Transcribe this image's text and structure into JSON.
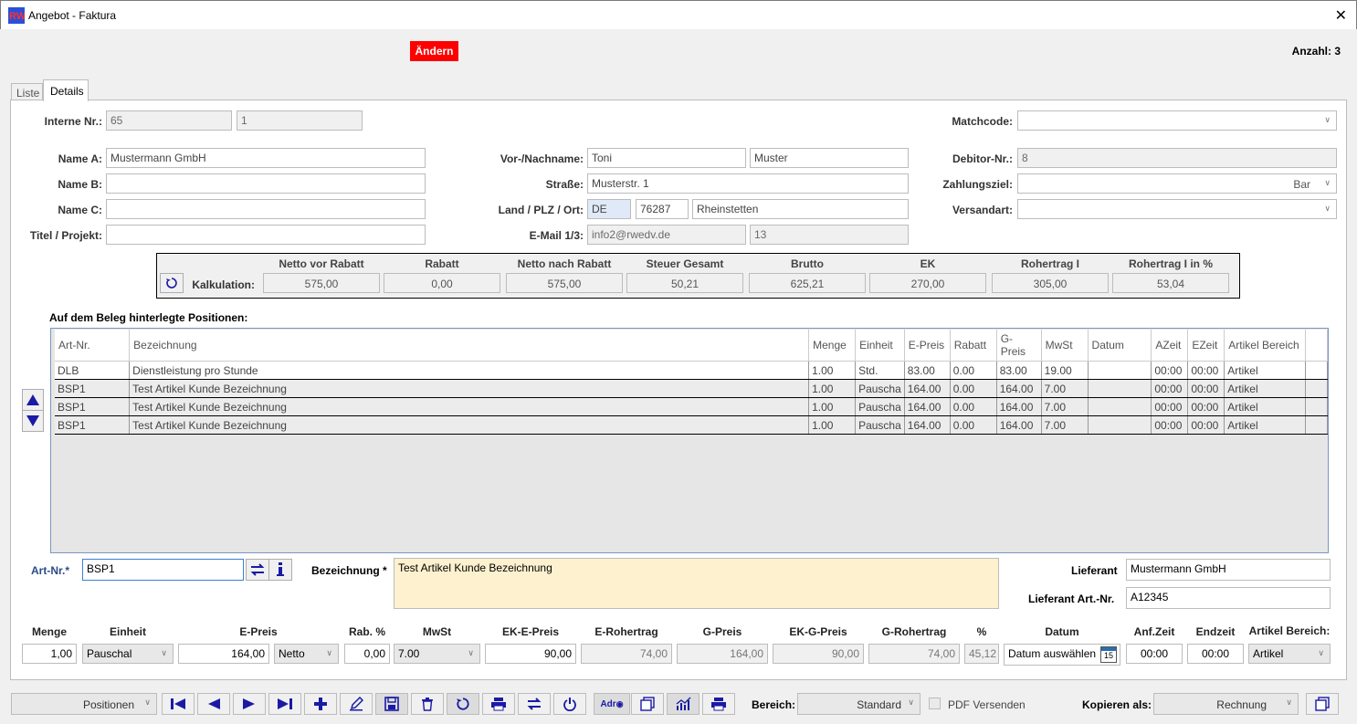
{
  "window": {
    "title": "Angebot - Faktura",
    "app_icon": "RW",
    "close_glyph": "✕"
  },
  "toolbar": {
    "change_button": "Ändern",
    "count_label": "Anzahl: 3"
  },
  "tabs": [
    {
      "label": "Liste"
    },
    {
      "label": "Details"
    }
  ],
  "head": {
    "interne_nr_label": "Interne Nr.:",
    "interne_nr": "65",
    "interne_nr2": "1",
    "matchcode_label": "Matchcode:",
    "matchcode": "",
    "name_a_label": "Name A:",
    "name_a": "Mustermann GmbH",
    "name_b_label": "Name B:",
    "name_b": "",
    "name_c_label": "Name C:",
    "name_c": "",
    "titel_label": "Titel / Projekt:",
    "titel": "",
    "vorname_label": "Vor-/Nachname:",
    "vorname": "Toni",
    "nachname": "Muster",
    "strasse_label": "Straße:",
    "strasse": "Musterstr. 1",
    "land_label": "Land / PLZ / Ort:",
    "land": "DE",
    "plz": "76287",
    "ort": "Rheinstetten",
    "email_label": "E-Mail 1/3:",
    "email": "info2@rwedv.de",
    "email_num": "13",
    "debitor_label": "Debitor-Nr.:",
    "debitor": "8",
    "zahlungsziel_label": "Zahlungsziel:",
    "zahlungsziel": "Bar",
    "versandart_label": "Versandart:",
    "versandart": ""
  },
  "kalkulation": {
    "label": "Kalkulation:",
    "columns": [
      {
        "head": "Netto vor Rabatt",
        "value": "575,00"
      },
      {
        "head": "Rabatt",
        "value": "0,00"
      },
      {
        "head": "Netto nach Rabatt",
        "value": "575,00"
      },
      {
        "head": "Steuer Gesamt",
        "value": "50,21"
      },
      {
        "head": "Brutto",
        "value": "625,21"
      },
      {
        "head": "EK",
        "value": "270,00"
      },
      {
        "head": "Rohertrag I",
        "value": "305,00"
      },
      {
        "head": "Rohertrag I in %",
        "value": "53,04"
      }
    ]
  },
  "positions": {
    "title": "Auf dem Beleg hinterlegte Positionen:",
    "columns": [
      "Art-Nr.",
      "Bezeichnung",
      "Menge",
      "Einheit",
      "E-Preis",
      "Rabatt",
      "G-Preis",
      "MwSt",
      "Datum",
      "AZeit",
      "EZeit",
      "Artikel Bereich"
    ],
    "rows": [
      [
        "DLB",
        "Dienstleistung pro Stunde",
        "1.00",
        "Std.",
        "83.00",
        "0.00",
        "83.00",
        "19.00",
        "",
        "00:00",
        "00:00",
        "Artikel"
      ],
      [
        "BSP1",
        "Test Artikel Kunde Bezeichnung",
        "1.00",
        "Pauscha",
        "164.00",
        "0.00",
        "164.00",
        "7.00",
        "",
        "00:00",
        "00:00",
        "Artikel"
      ],
      [
        "BSP1",
        "Test Artikel Kunde Bezeichnung",
        "1.00",
        "Pauscha",
        "164.00",
        "0.00",
        "164.00",
        "7.00",
        "",
        "00:00",
        "00:00",
        "Artikel"
      ],
      [
        "BSP1",
        "Test Artikel Kunde Bezeichnung",
        "1.00",
        "Pauscha",
        "164.00",
        "0.00",
        "164.00",
        "7.00",
        "",
        "00:00",
        "00:00",
        "Artikel"
      ]
    ]
  },
  "edit": {
    "artnr_label": "Art-Nr.*",
    "artnr": "BSP1",
    "bez_label": "Bezeichnung *",
    "bez": "Test Artikel Kunde Bezeichnung",
    "lieferant_label": "Lieferant",
    "lieferant": "Mustermann GmbH",
    "lief_artnr_label": "Lieferant Art.-Nr.",
    "lief_artnr": "A12345",
    "heads": {
      "menge": "Menge",
      "einheit": "Einheit",
      "epreis": "E-Preis",
      "rab": "Rab. %",
      "mwst": "MwSt",
      "ekepreis": "EK-E-Preis",
      "erohertrag": "E-Rohertrag",
      "gpreis": "G-Preis",
      "ekgpreis": "EK-G-Preis",
      "grohertrag": "G-Rohertrag",
      "pct": "%",
      "datum": "Datum",
      "anfzeit": "Anf.Zeit",
      "endzeit": "Endzeit",
      "bereich": "Artikel Bereich:"
    },
    "values": {
      "menge": "1,00",
      "einheit": "Pauschal",
      "epreis": "164,00",
      "netto": "Netto",
      "rab": "0,00",
      "mwst": "7.00",
      "ekepreis": "90,00",
      "erohertrag": "74,00",
      "gpreis": "164,00",
      "ekgpreis": "90,00",
      "grohertrag": "74,00",
      "pct": "45,12",
      "datum": "Datum auswählen",
      "datum_icon_day": "15",
      "anfzeit": "00:00",
      "endzeit": "00:00",
      "bereich": "Artikel"
    }
  },
  "bottom": {
    "positionen": "Positionen",
    "adr": "Adr",
    "bereich_label": "Bereich:",
    "bereich": "Standard",
    "pdf_label": "PDF Versenden",
    "kopieren_label": "Kopieren als:",
    "kopieren": "Rechnung"
  },
  "colors": {
    "accent": "#1a1aa6",
    "change": "#ff0000",
    "highlight": "#fdf1cf"
  }
}
